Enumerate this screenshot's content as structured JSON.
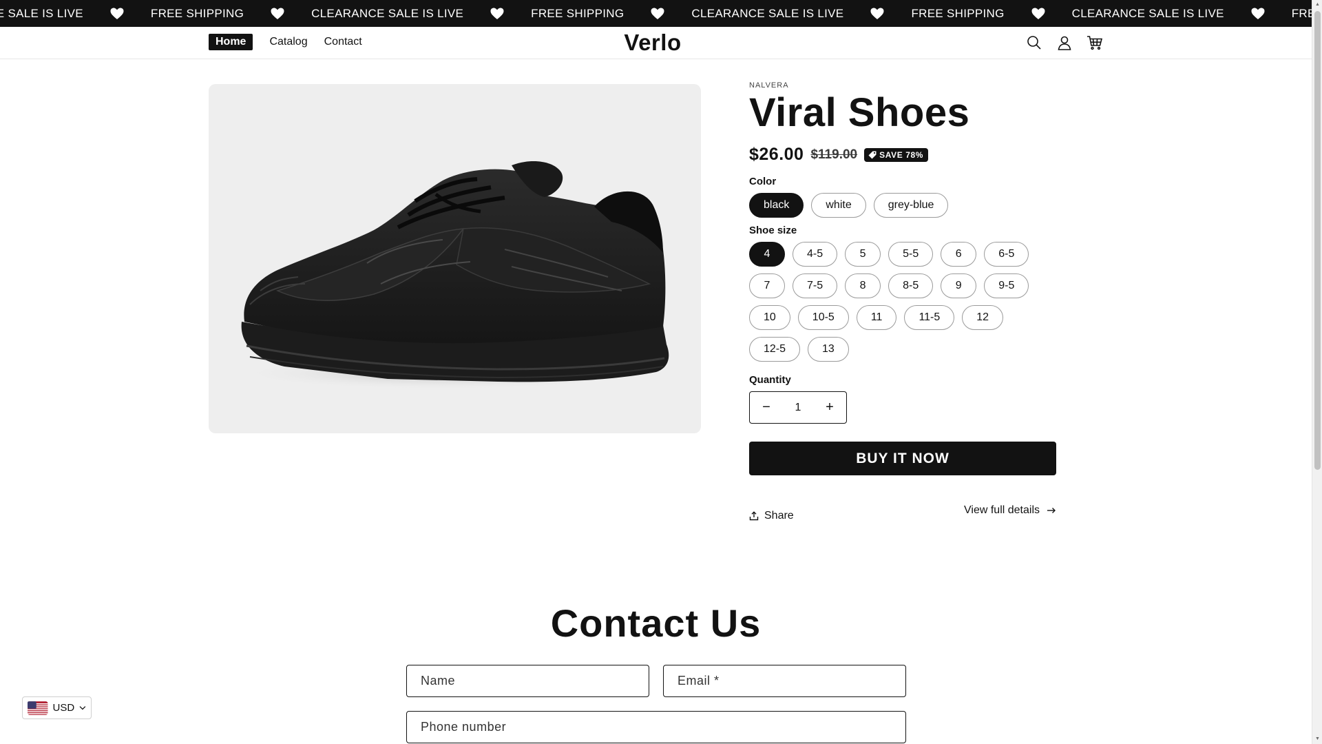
{
  "announcement": {
    "items": [
      "ANCE SALE IS LIVE",
      "FREE SHIPPING",
      "CLEARANCE SALE IS LIVE",
      "FREE SHIPPING",
      "CLEARANCE SALE IS LIVE",
      "FREE SHIPPING",
      "CLEARANCE SALE IS LIVE",
      "FREE SHIPPING"
    ],
    "separator_icon": "heart-icon"
  },
  "header": {
    "nav": [
      {
        "label": "Home",
        "active": true
      },
      {
        "label": "Catalog",
        "active": false
      },
      {
        "label": "Contact",
        "active": false
      }
    ],
    "logo": "Verlo",
    "icons": [
      "search-icon",
      "account-icon",
      "cart-icon"
    ]
  },
  "product": {
    "vendor": "NALVERA",
    "title": "Viral Shoes",
    "price": "$26.00",
    "compare_price": "$119.00",
    "badge": "SAVE 78%",
    "color_label": "Color",
    "colors": [
      "black",
      "white",
      "grey-blue"
    ],
    "selected_color": "black",
    "size_label": "Shoe size",
    "sizes": [
      "4",
      "4-5",
      "5",
      "5-5",
      "6",
      "6-5",
      "7",
      "7-5",
      "8",
      "8-5",
      "9",
      "9-5",
      "10",
      "10-5",
      "11",
      "11-5",
      "12",
      "12-5",
      "13"
    ],
    "selected_size": "4",
    "quantity_label": "Quantity",
    "quantity": "1",
    "buy_label": "BUY IT NOW",
    "share_label": "Share",
    "details_label": "View full details"
  },
  "contact": {
    "title": "Contact Us",
    "name_placeholder": "Name",
    "email_placeholder": "Email *",
    "phone_placeholder": "Phone number"
  },
  "currency": {
    "code": "USD"
  },
  "colors": {
    "primary": "#121212",
    "media_bg": "#eeeeee"
  }
}
